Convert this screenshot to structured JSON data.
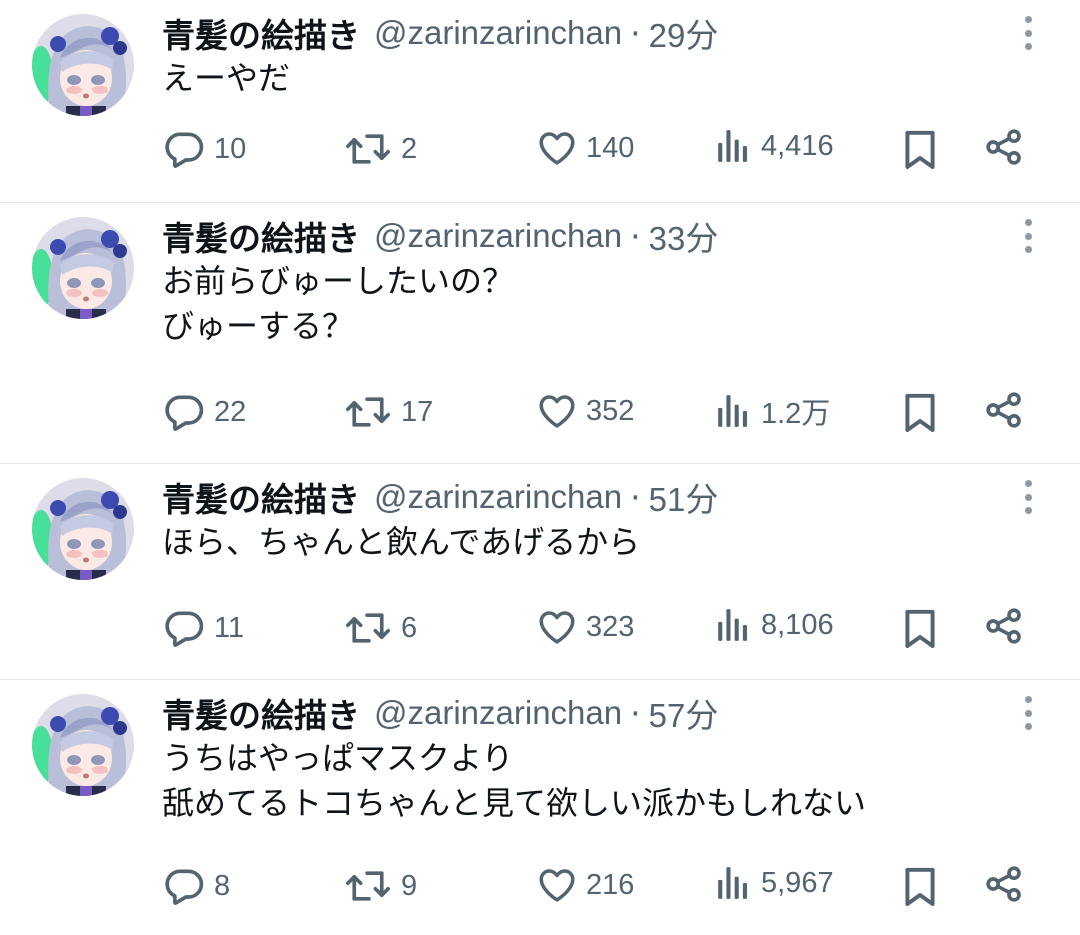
{
  "tweets": [
    {
      "name": "青髪の絵描き",
      "handle": "@zarinzarinchan",
      "time": "29分",
      "lines": [
        "えーやだ"
      ],
      "replies": "10",
      "retweets": "2",
      "likes": "140",
      "views": "4,416"
    },
    {
      "name": "青髪の絵描き",
      "handle": "@zarinzarinchan",
      "time": "33分",
      "lines": [
        "お前らびゅーしたいの？",
        "びゅーする？"
      ],
      "replies": "22",
      "retweets": "17",
      "likes": "352",
      "views": "1.2万"
    },
    {
      "name": "青髪の絵描き",
      "handle": "@zarinzarinchan",
      "time": "51分",
      "lines": [
        "ほら、ちゃんと飲んであげるから"
      ],
      "replies": "11",
      "retweets": "6",
      "likes": "323",
      "views": "8,106"
    },
    {
      "name": "青髪の絵描き",
      "handle": "@zarinzarinchan",
      "time": "57分",
      "lines": [
        "うちはやっぱマスクより",
        "舐めてるトコちゃんと見て欲しい派かもしれない"
      ],
      "replies": "8",
      "retweets": "9",
      "likes": "216",
      "views": "5,967"
    }
  ],
  "separator": "·",
  "icons": {
    "reply": "speech-bubble-icon",
    "retweet": "retweet-arrows-icon",
    "like": "heart-icon",
    "views": "bar-chart-icon",
    "bookmark": "bookmark-icon",
    "share": "share-nodes-icon",
    "more": "vertical-dots-icon"
  },
  "colors": {
    "text": "#0f1419",
    "secondary": "#536471",
    "divider": "#e1e6ea",
    "avatar_hair": "#b9bfd9",
    "avatar_accent": "#3b4bb0",
    "avatar_glow": "#2de08a"
  }
}
